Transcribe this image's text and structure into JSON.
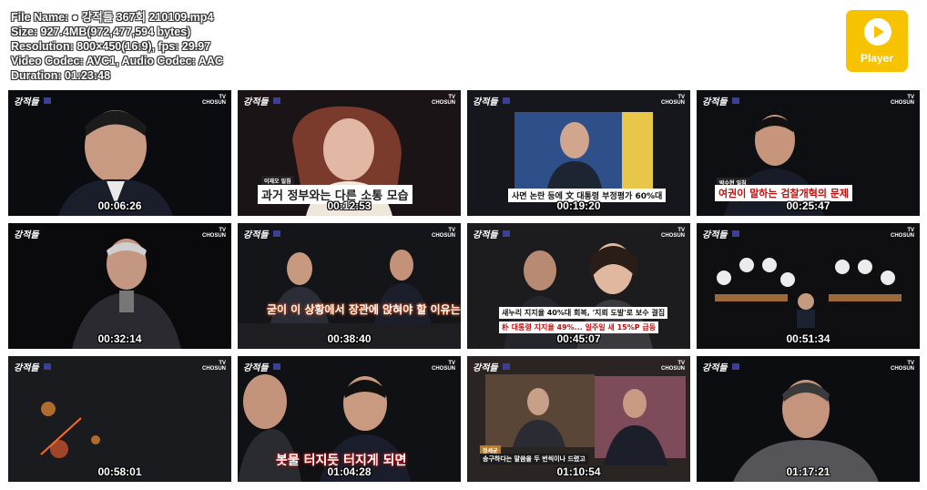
{
  "info": {
    "file_name": "File Name: ● 강적들 367회 210109.mp4",
    "size": "Size: 927.4MB(972,477,594 bytes)",
    "resolution": "Resolution: 800×450(16:9), fps: 29.97",
    "codec": "Video Codec: AVC1, Audio Codec: AAC",
    "duration": "Duration: 01:23:48"
  },
  "player": {
    "label": "Player",
    "icon": "play-icon",
    "accent": "#f7c300"
  },
  "thumbnails": [
    {
      "timestamp": "00:06:26",
      "caption": ""
    },
    {
      "timestamp": "00:12:53",
      "name_tag": "이재오 일침",
      "caption": "과거 정부와는 다른 소통 모습"
    },
    {
      "timestamp": "00:19:20",
      "caption": "사면 논란 등에 文 대통령 부정평가 60%대"
    },
    {
      "timestamp": "00:25:47",
      "name_tag": "박수현 일침",
      "caption": "여권이 말하는 검찰개혁의 문제"
    },
    {
      "timestamp": "00:32:14",
      "caption": ""
    },
    {
      "timestamp": "00:38:40",
      "caption": "굳이 이 상황에서 장관에 앉혀야 할 이유는?"
    },
    {
      "timestamp": "00:45:07",
      "caption": "새누리 지지율 40%대 회복, '지뢰 도발'로 보수 결집",
      "caption2": "朴 대통령 지지율 49%... 일주일 새 15%P 급등"
    },
    {
      "timestamp": "00:51:34",
      "caption": ""
    },
    {
      "timestamp": "00:58:01",
      "caption": ""
    },
    {
      "timestamp": "01:04:28",
      "caption": "봇물 터지듯 터지게 되면"
    },
    {
      "timestamp": "01:10:54",
      "name_tag": "정세균",
      "caption": "송구하다는 말씀을 두 번씩이나 드렸고"
    },
    {
      "timestamp": "01:17:21",
      "caption": ""
    }
  ]
}
